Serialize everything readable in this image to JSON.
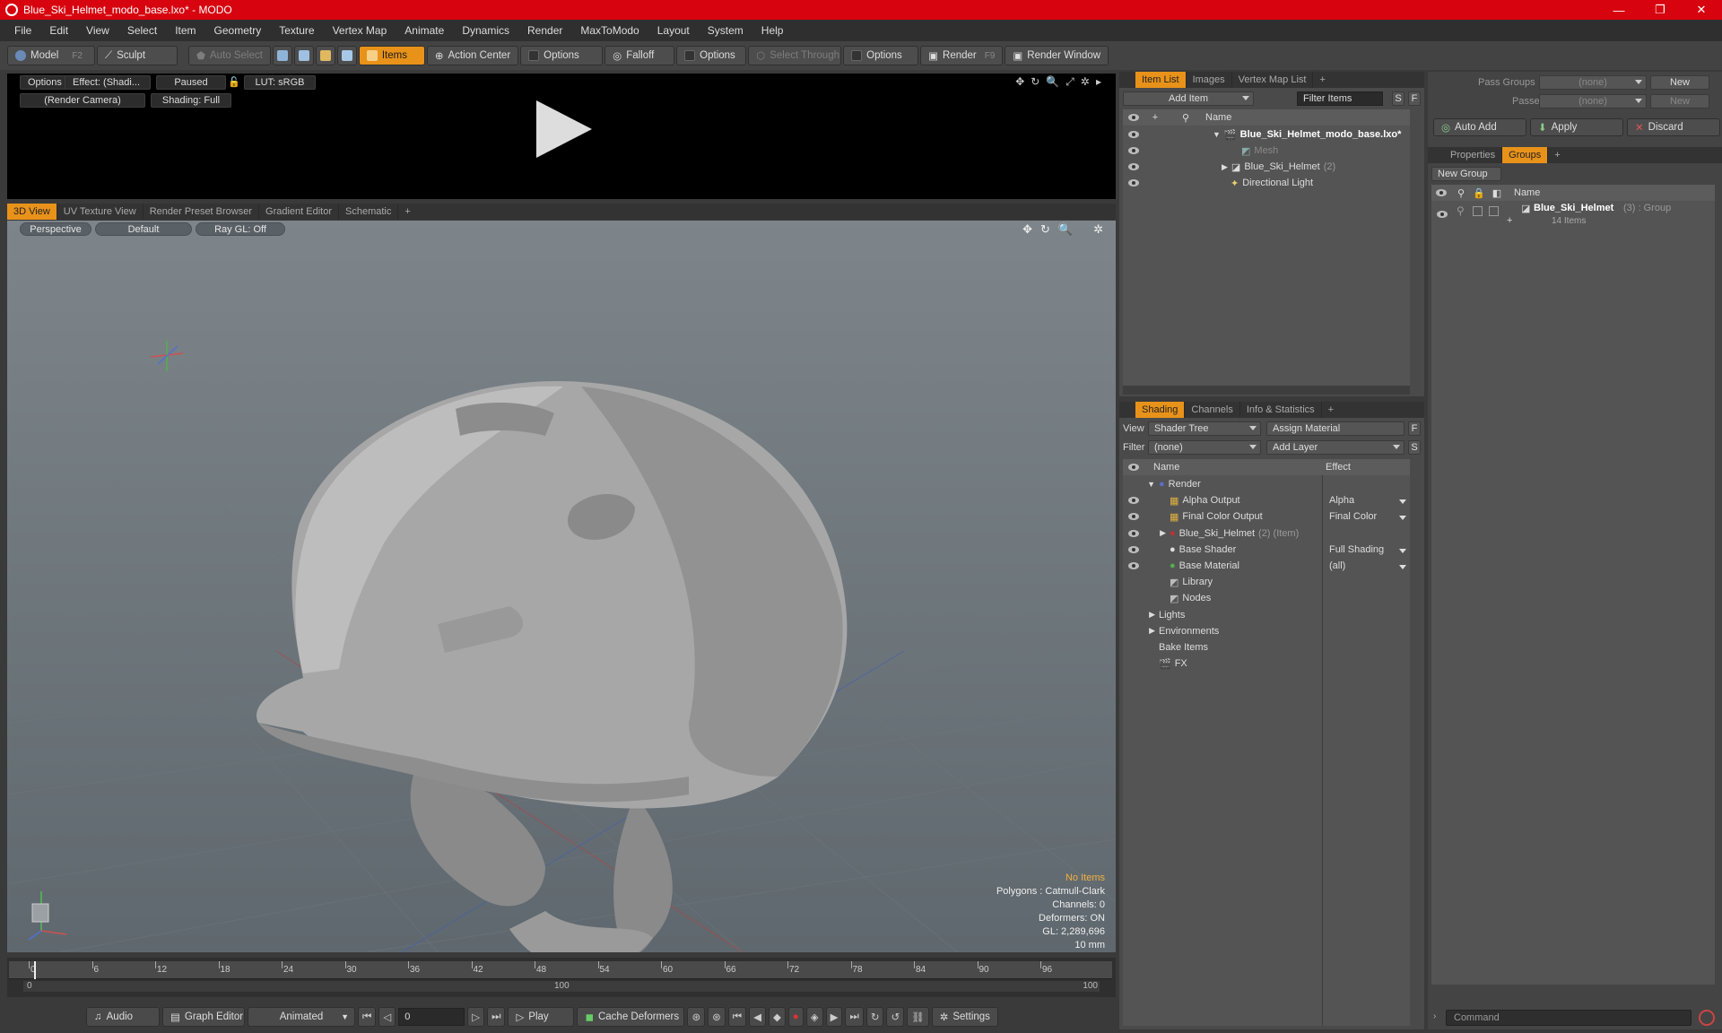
{
  "window": {
    "title": "Blue_Ski_Helmet_modo_base.lxo* - MODO",
    "minimize": "—",
    "maximize": "❐",
    "close": "✕"
  },
  "menu": [
    "File",
    "Edit",
    "View",
    "Select",
    "Item",
    "Geometry",
    "Texture",
    "Vertex Map",
    "Animate",
    "Dynamics",
    "Render",
    "MaxToModo",
    "Layout",
    "System",
    "Help"
  ],
  "toolbar": {
    "model": "Model",
    "model_key": "F2",
    "sculpt": "Sculpt",
    "auto_select": "Auto Select",
    "items": "Items",
    "action_center": "Action Center",
    "options1": "Options",
    "falloff": "Falloff",
    "options2": "Options",
    "select_through": "Select Through",
    "options3": "Options",
    "render": "Render",
    "render_key": "F9",
    "render_window": "Render Window"
  },
  "preview": {
    "options": "Options",
    "effect": "Effect: (Shadi...",
    "paused": "Paused",
    "lut": "LUT: sRGB",
    "camera": "(Render Camera)",
    "shading": "Shading: Full"
  },
  "viewport_tabs": [
    "3D View",
    "UV Texture View",
    "Render Preset Browser",
    "Gradient Editor",
    "Schematic",
    "+"
  ],
  "viewport": {
    "perspective": "Perspective",
    "default": "Default",
    "raygl": "Ray GL: Off"
  },
  "stats": {
    "no_items": "No Items",
    "polygons": "Polygons : Catmull-Clark",
    "channels": "Channels: 0",
    "deformers": "Deformers: ON",
    "gl": "GL: 2,289,696",
    "scale": "10 mm"
  },
  "timeline": {
    "ticks": [
      "0",
      "6",
      "12",
      "18",
      "24",
      "30",
      "36",
      "42",
      "48",
      "54",
      "60",
      "66",
      "72",
      "78",
      "84",
      "90",
      "96"
    ],
    "start": "0",
    "mid": "100",
    "end": "100"
  },
  "bottom": {
    "audio": "Audio",
    "graph_editor": "Graph Editor",
    "animated": "Animated",
    "frame": "0",
    "play": "Play",
    "cache_deformers": "Cache Deformers",
    "settings": "Settings"
  },
  "item_list": {
    "tabs": [
      "Item List",
      "Images",
      "Vertex Map List",
      "+"
    ],
    "add_item": "Add Item",
    "filter_items": "Filter Items",
    "s": "S",
    "f": "F",
    "col_name": "Name",
    "items": [
      {
        "label": "Blue_Ski_Helmet_modo_base.lxo*",
        "bold": true
      },
      {
        "label": "Mesh",
        "dim": true
      },
      {
        "label": "Blue_Ski_Helmet",
        "count": "(2)"
      },
      {
        "label": "Directional Light"
      }
    ]
  },
  "shading": {
    "tabs": [
      "Shading",
      "Channels",
      "Info & Statistics",
      "+"
    ],
    "view_label": "View",
    "view_value": "Shader Tree",
    "assign_material": "Assign Material",
    "f": "F",
    "filter_label": "Filter",
    "filter_value": "(none)",
    "add_layer": "Add Layer",
    "s": "S",
    "col_name": "Name",
    "col_effect": "Effect",
    "rows": [
      {
        "name": "Render",
        "effect": ""
      },
      {
        "name": "Alpha Output",
        "effect": "Alpha"
      },
      {
        "name": "Final Color Output",
        "effect": "Final Color"
      },
      {
        "name": "Blue_Ski_Helmet",
        "extra": "(2) (Item)",
        "effect": ""
      },
      {
        "name": "Base Shader",
        "effect": "Full Shading"
      },
      {
        "name": "Base Material",
        "effect": "(all)"
      },
      {
        "name": "Library",
        "effect": ""
      },
      {
        "name": "Nodes",
        "effect": ""
      },
      {
        "name": "Lights",
        "effect": ""
      },
      {
        "name": "Environments",
        "effect": ""
      },
      {
        "name": "Bake Items",
        "effect": ""
      },
      {
        "name": "FX",
        "effect": ""
      }
    ]
  },
  "groups": {
    "pass_groups_label": "Pass Groups",
    "pass_groups_value": "(none)",
    "new": "New",
    "passes_label": "Passes",
    "passes_value": "(none)",
    "new2": "New",
    "auto_add": "Auto Add",
    "apply": "Apply",
    "discard": "Discard",
    "tabs": [
      "Properties",
      "Groups",
      "+"
    ],
    "new_group": "New Group",
    "col_name": "Name",
    "group_name": "Blue_Ski_Helmet",
    "group_meta": "(3) : Group",
    "group_items": "14 Items"
  },
  "command": {
    "placeholder": "Command"
  }
}
